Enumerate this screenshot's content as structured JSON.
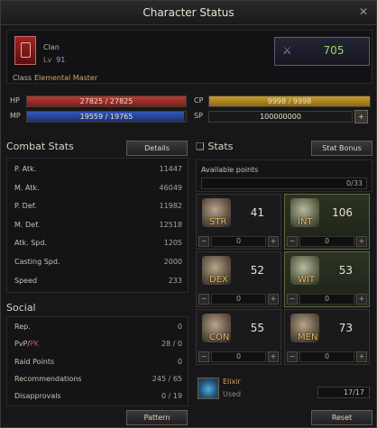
{
  "window": {
    "title": "Character Status",
    "close": "✕"
  },
  "header": {
    "clan_label": "Clan",
    "lv_label": "Lv",
    "level": "91",
    "class_label": "Class",
    "class_value": "Elemental Master",
    "power": "705",
    "power_icon": "sword-emblem-icon"
  },
  "bars": {
    "hp": {
      "label": "HP",
      "text": "27825 / 27825",
      "fraction": 1.0,
      "color": "#b83a33"
    },
    "mp": {
      "label": "MP",
      "text": "19559 / 19765",
      "fraction": 0.99,
      "color": "#3457b6"
    },
    "cp": {
      "label": "CP",
      "text": "9998 / 9998",
      "fraction": 1.0,
      "color": "#c89c2c"
    },
    "sp": {
      "label": "SP",
      "text": "100000000",
      "button": "+"
    }
  },
  "combat": {
    "title": "Combat Stats",
    "details_button": "Details",
    "rows": [
      {
        "k": "P. Atk.",
        "v": "11447"
      },
      {
        "k": "M. Atk.",
        "v": "46049"
      },
      {
        "k": "P. Def.",
        "v": "11982"
      },
      {
        "k": "M. Def.",
        "v": "12518"
      },
      {
        "k": "Atk. Spd.",
        "v": "1205"
      },
      {
        "k": "Casting Spd.",
        "v": "2000"
      },
      {
        "k": "Speed",
        "v": "233"
      }
    ]
  },
  "social": {
    "title": "Social",
    "rows": [
      {
        "k": "Rep.",
        "v": "0"
      },
      {
        "k": "PvP/",
        "k2": "PK",
        "v": "28 / 0"
      },
      {
        "k": "Raid Points",
        "v": "0"
      },
      {
        "k": "Recommendations",
        "v": "245 / 65"
      },
      {
        "k": "Disapprovals",
        "v": "0 / 19"
      }
    ]
  },
  "stats": {
    "title": "Stats",
    "bonus_button": "Stat Bonus",
    "available_label": "Available points",
    "available_value": "0/33",
    "items": [
      {
        "name": "STR",
        "value": "41",
        "extra": "0",
        "highlight": false,
        "icon": "fist-icon"
      },
      {
        "name": "INT",
        "value": "106",
        "extra": "0",
        "highlight": true,
        "icon": "book-icon"
      },
      {
        "name": "DEX",
        "value": "52",
        "extra": "0",
        "highlight": false,
        "icon": "boot-icon"
      },
      {
        "name": "WIT",
        "value": "53",
        "extra": "0",
        "highlight": true,
        "icon": "hand-icon"
      },
      {
        "name": "CON",
        "value": "55",
        "extra": "0",
        "highlight": false,
        "icon": "heart-icon"
      },
      {
        "name": "MEN",
        "value": "73",
        "extra": "0",
        "highlight": false,
        "icon": "mind-icon"
      }
    ],
    "minus": "−",
    "plus": "+"
  },
  "elixir": {
    "name": "Elixir",
    "status": "Used",
    "count": "17/17",
    "icon": "potion-icon"
  },
  "footer": {
    "pattern_button": "Pattern",
    "reset_button": "Reset"
  }
}
